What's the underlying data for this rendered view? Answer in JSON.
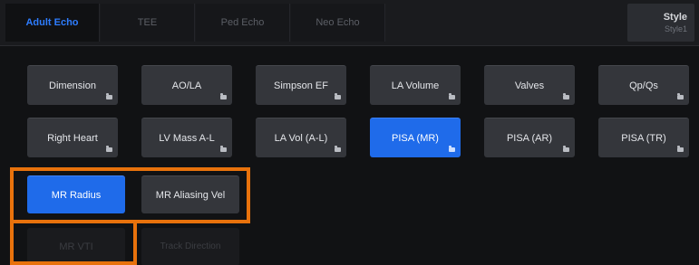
{
  "tabs": [
    {
      "label": "Adult Echo",
      "active": true
    },
    {
      "label": "TEE",
      "active": false
    },
    {
      "label": "Ped Echo",
      "active": false
    },
    {
      "label": "Neo Echo",
      "active": false
    }
  ],
  "style_button": {
    "title": "Style",
    "value": "Style1"
  },
  "measurement_buttons": {
    "row1": [
      "Dimension",
      "AO/LA",
      "Simpson EF",
      "LA Volume",
      "Valves",
      "Qp/Qs"
    ],
    "row2": [
      "Right Heart",
      "LV Mass A-L",
      "LA Vol (A-L)",
      "PISA (MR)",
      "PISA (AR)",
      "PISA (TR)"
    ],
    "selected": "PISA (MR)"
  },
  "sub_measurements": {
    "items": [
      "MR Radius",
      "MR Aliasing Vel",
      "MR VTI",
      "Track Direction"
    ],
    "active": "MR Radius"
  },
  "colors": {
    "accent": "#1f6bea",
    "highlight": "#e8720c",
    "background": "#111214"
  }
}
